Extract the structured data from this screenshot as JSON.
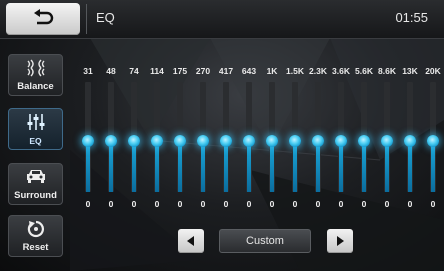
{
  "header": {
    "title": "EQ",
    "clock": "01:55",
    "back_icon": "back-arrow-icon"
  },
  "sidebar": {
    "items": [
      {
        "label": "Balance",
        "icon": "balance-icon",
        "active": false
      },
      {
        "label": "EQ",
        "icon": "equalizer-icon",
        "active": true
      },
      {
        "label": "Surround",
        "icon": "car-icon",
        "active": false
      },
      {
        "label": "Reset",
        "icon": "reset-icon",
        "active": false
      }
    ]
  },
  "equalizer": {
    "bands": [
      {
        "freq": "31",
        "gain": "0"
      },
      {
        "freq": "48",
        "gain": "0"
      },
      {
        "freq": "74",
        "gain": "0"
      },
      {
        "freq": "114",
        "gain": "0"
      },
      {
        "freq": "175",
        "gain": "0"
      },
      {
        "freq": "270",
        "gain": "0"
      },
      {
        "freq": "417",
        "gain": "0"
      },
      {
        "freq": "643",
        "gain": "0"
      },
      {
        "freq": "1K",
        "gain": "0"
      },
      {
        "freq": "1.5K",
        "gain": "0"
      },
      {
        "freq": "2.3K",
        "gain": "0"
      },
      {
        "freq": "3.6K",
        "gain": "0"
      },
      {
        "freq": "5.6K",
        "gain": "0"
      },
      {
        "freq": "8.6K",
        "gain": "0"
      },
      {
        "freq": "13K",
        "gain": "0"
      },
      {
        "freq": "20K",
        "gain": "0"
      }
    ],
    "preset": "Custom",
    "accent_color": "#1aa6d8"
  }
}
